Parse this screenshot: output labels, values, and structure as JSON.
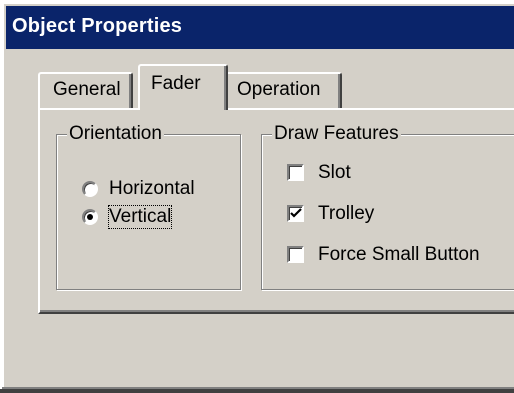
{
  "window": {
    "title": "Object Properties"
  },
  "tabs": [
    {
      "label": "General",
      "selected": false
    },
    {
      "label": "Fader",
      "selected": true
    },
    {
      "label": "Operation",
      "selected": false
    }
  ],
  "orientation": {
    "legend": "Orientation",
    "options": [
      {
        "label": "Horizontal",
        "selected": false
      },
      {
        "label": "Vertical",
        "selected": true
      }
    ]
  },
  "draw_features": {
    "legend": "Draw Features",
    "options": [
      {
        "label": "Slot",
        "checked": false
      },
      {
        "label": "Trolley",
        "checked": true
      },
      {
        "label": "Force Small Button",
        "checked": false
      }
    ]
  },
  "colors": {
    "titlebar": "#0a246a",
    "face": "#d4d0c8"
  }
}
